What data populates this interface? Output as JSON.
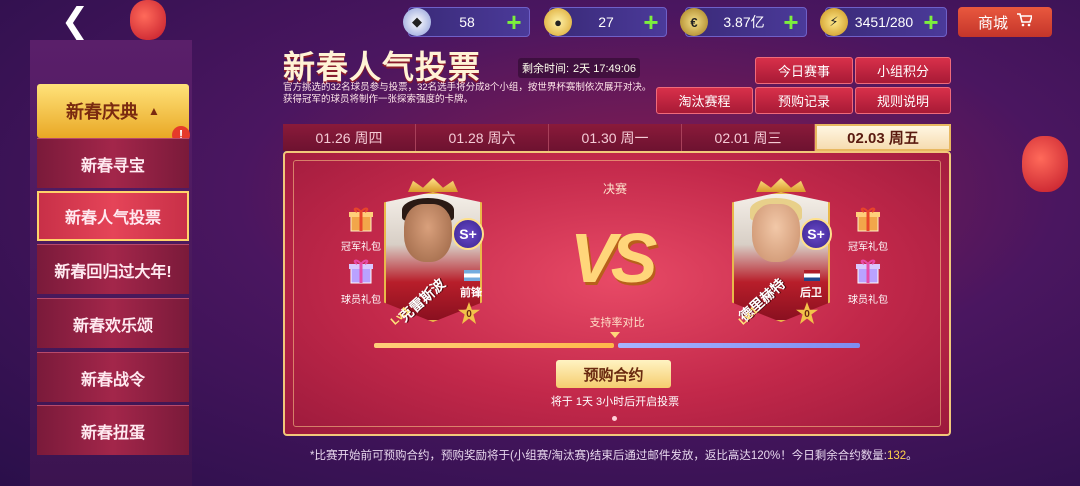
{
  "topbar": {
    "resources": [
      {
        "icon": "diamond-icon",
        "value": "58"
      },
      {
        "icon": "gold-coin-icon",
        "value": "27"
      },
      {
        "icon": "euro-coin-icon",
        "value": "3.87亿"
      },
      {
        "icon": "energy-icon",
        "value": "3451/280"
      }
    ],
    "shop_label": "商城"
  },
  "sidebar": {
    "header": "新春庆典",
    "items": [
      {
        "label": "新春寻宝"
      },
      {
        "label": "新春人气投票"
      },
      {
        "label": "新春回归过大年!"
      },
      {
        "label": "新春欢乐颂"
      },
      {
        "label": "新春战令"
      },
      {
        "label": "新春扭蛋"
      }
    ],
    "active_index": 1
  },
  "header": {
    "title": "新春人气投票",
    "timer_label": "剩余时间:",
    "timer_value": "2天 17:49:06",
    "description": "官方挑选的32名球员参与投票，32名选手将分成8个小组，按世界杯赛制依次展开对决。获得冠军的球员将制作一张探索强度的卡牌。"
  },
  "menu": [
    "今日赛事",
    "小组积分",
    "淘汰赛程",
    "预购记录",
    "规则说明"
  ],
  "tabs": [
    {
      "label": "01.26 周四"
    },
    {
      "label": "01.28 周六"
    },
    {
      "label": "01.30 周一"
    },
    {
      "label": "02.01 周三"
    },
    {
      "label": "02.03 周五"
    }
  ],
  "match": {
    "round": "决赛",
    "vs": "VS",
    "ratio_label": "支持率对比",
    "left": {
      "name": "克雷斯波",
      "position": "前锋",
      "grade": "S+",
      "level": "Lv.1",
      "stars": "0",
      "gift1": "冠军礼包",
      "gift2": "球员礼包"
    },
    "right": {
      "name": "德里赫特",
      "position": "后卫",
      "grade": "S+",
      "level": "Lv.1",
      "stars": "0",
      "gift1": "冠军礼包",
      "gift2": "球员礼包"
    },
    "preorder_button": "预购合约",
    "vote_tip": "将于 1天 3小时后开启投票"
  },
  "footnote": {
    "text": "*比赛开始前可预购合约，预购奖励将于(小组赛/淘汰赛)结束后通过邮件发放，返比高达120%！今日剩余合约数量:",
    "count": "132",
    "end": "。"
  }
}
